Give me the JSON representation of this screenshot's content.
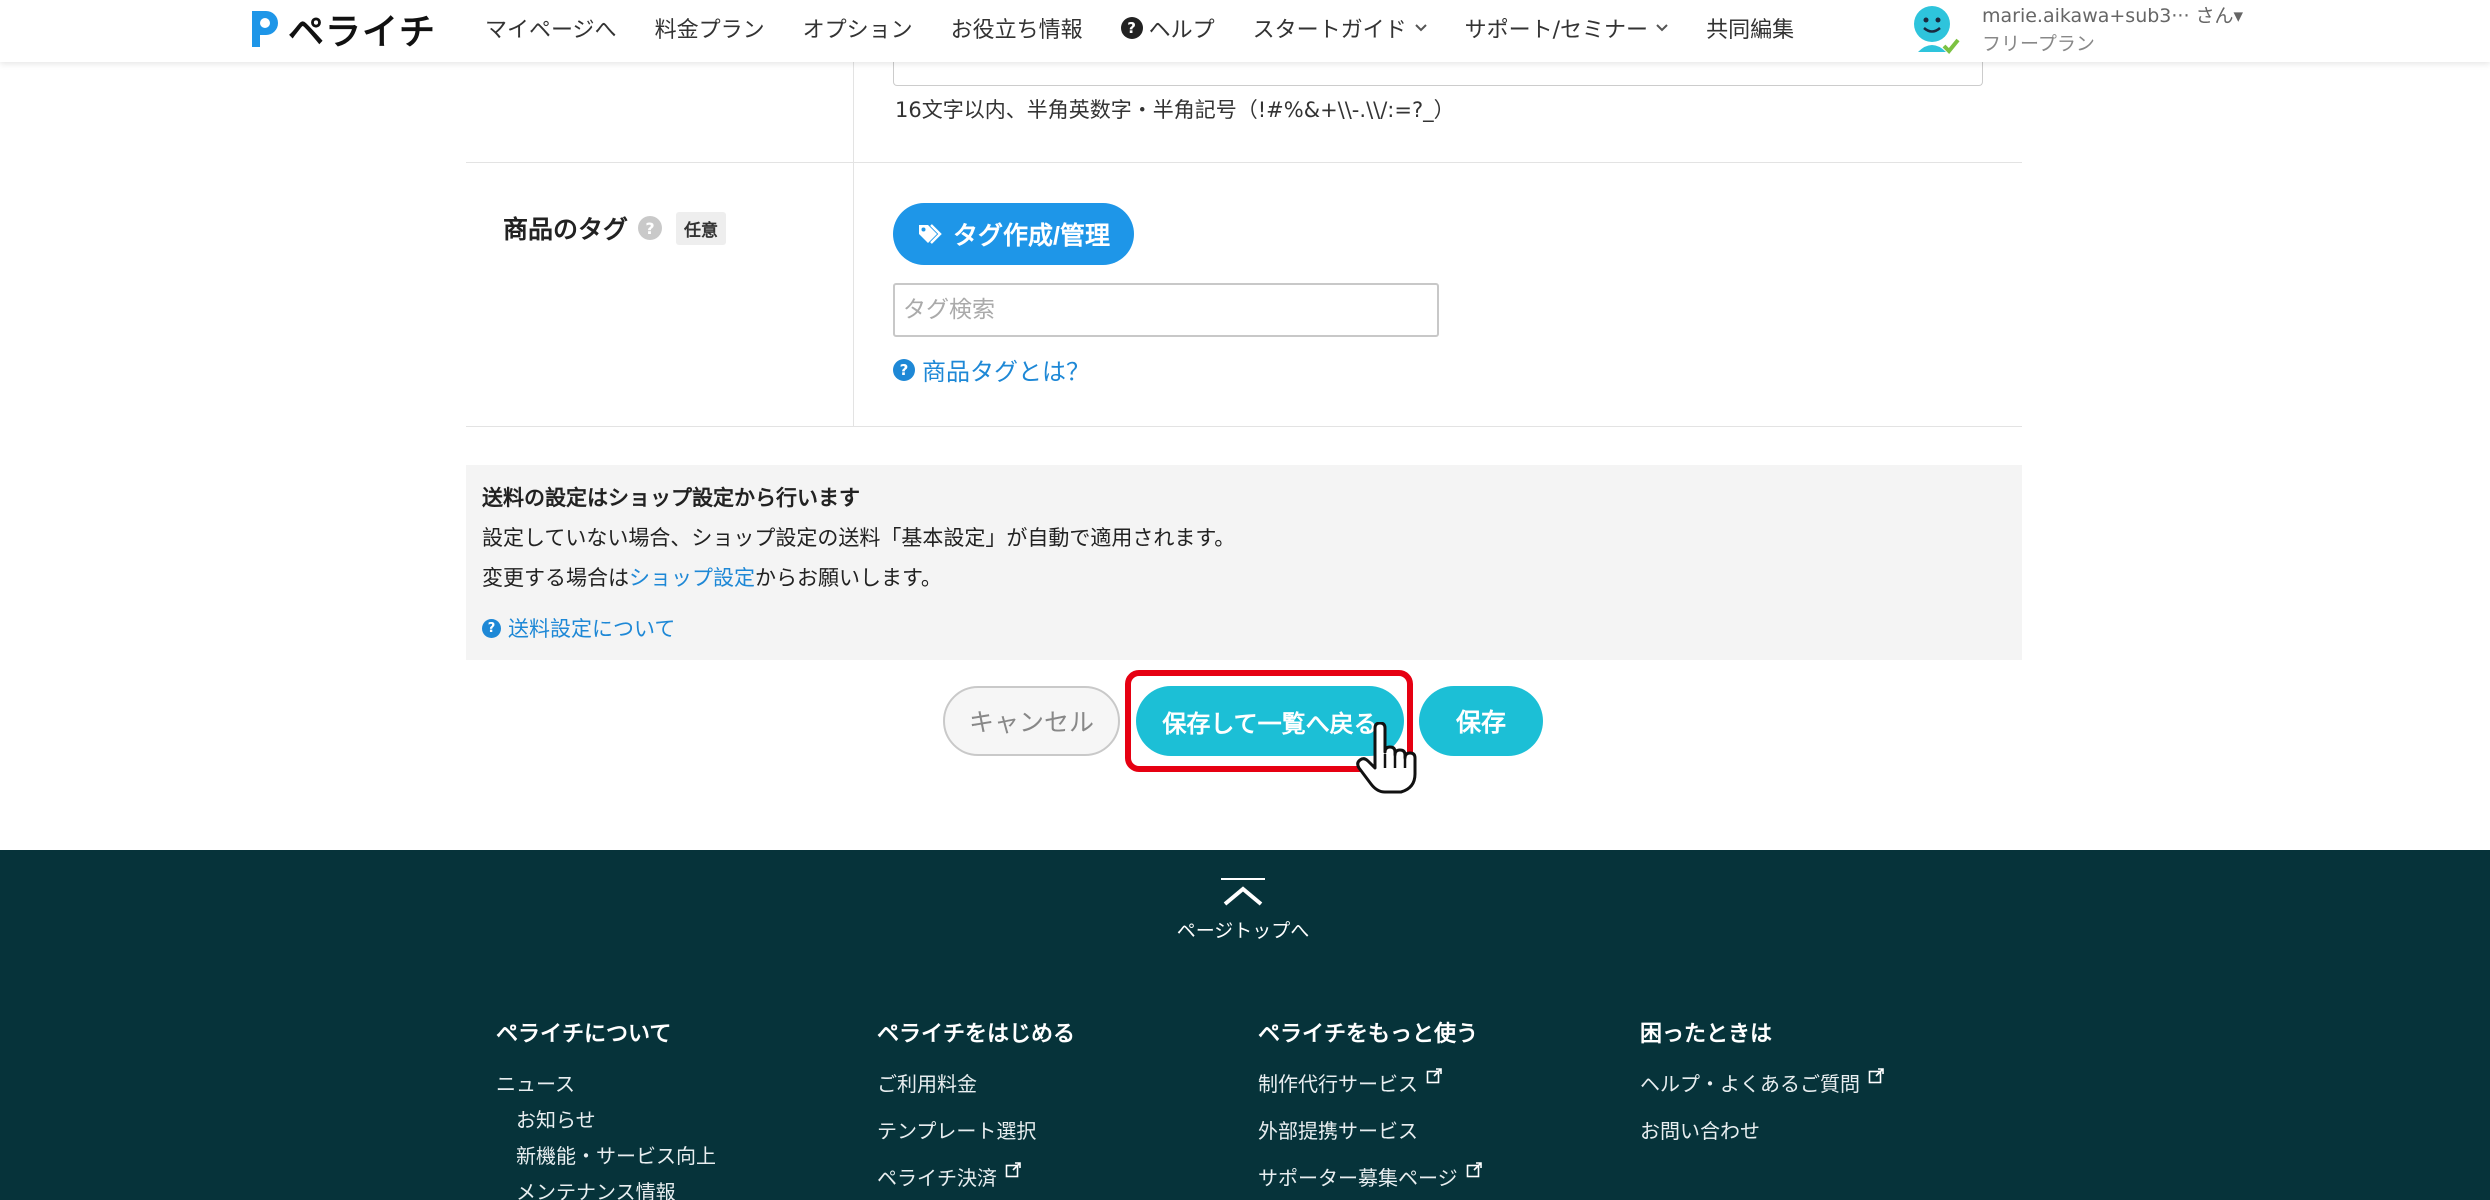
{
  "header": {
    "logo_text": "ペライチ",
    "nav": [
      {
        "label": "マイページへ",
        "dropdown": false
      },
      {
        "label": "料金プラン",
        "dropdown": false
      },
      {
        "label": "オプション",
        "dropdown": false
      },
      {
        "label": "お役立ち情報",
        "dropdown": false
      },
      {
        "label": "ヘルプ",
        "dropdown": false
      },
      {
        "label": "スタートガイド",
        "dropdown": true
      },
      {
        "label": "サポート/セミナー",
        "dropdown": true
      },
      {
        "label": "共同編集",
        "dropdown": false
      }
    ],
    "help_glyph": "?",
    "user_name": "marie.aikawa+sub3··· さん▾",
    "user_plan": "フリープラン"
  },
  "form": {
    "password_hint": "16文字以内、半角英数字・半角記号（!#%&+\\\\-.\\\\/:=?_）",
    "tag_label": "商品のタグ",
    "question_glyph": "?",
    "optional_badge": "任意",
    "tag_button_label": "タグ作成/管理",
    "tag_search_placeholder": "タグ検索",
    "tag_help_link": "商品タグとは？"
  },
  "notice": {
    "title": "送料の設定はショップ設定から行います",
    "line1": "設定していない場合、ショップ設定の送料「基本設定」が自動で適用されます。",
    "line2_prefix": "変更する場合は",
    "line2_link": "ショップ設定",
    "line2_suffix": "からお願いします。",
    "help_link": "送料設定について"
  },
  "buttons": {
    "cancel": "キャンセル",
    "save_and_back": "保存して一覧へ戻る",
    "save": "保存"
  },
  "footer": {
    "page_top": "ページトップへ",
    "columns": [
      {
        "title": "ペライチについて",
        "items": [
          {
            "label": "ニュース",
            "sub": false,
            "external": false
          },
          {
            "label": "お知らせ",
            "sub": true,
            "external": false
          },
          {
            "label": "新機能・サービス向上",
            "sub": true,
            "external": false
          },
          {
            "label": "メンテナンス情報",
            "sub": true,
            "external": false
          }
        ]
      },
      {
        "title": "ペライチをはじめる",
        "items": [
          {
            "label": "ご利用料金",
            "sub": false,
            "external": false
          },
          {
            "label": "テンプレート選択",
            "sub": false,
            "external": false
          },
          {
            "label": "ペライチ決済",
            "sub": false,
            "external": true
          }
        ]
      },
      {
        "title": "ペライチをもっと使う",
        "items": [
          {
            "label": "制作代行サービス",
            "sub": false,
            "external": true
          },
          {
            "label": "外部提携サービス",
            "sub": false,
            "external": false
          },
          {
            "label": "サポーター募集ページ",
            "sub": false,
            "external": true
          }
        ]
      },
      {
        "title": "困ったときは",
        "items": [
          {
            "label": "ヘルプ・よくあるご質問",
            "sub": false,
            "external": true
          },
          {
            "label": "お問い合わせ",
            "sub": false,
            "external": false
          }
        ]
      }
    ]
  },
  "colors": {
    "brand_blue": "#1e96e8",
    "save_button": "#1cbfd6",
    "highlight_red": "#e60012",
    "footer_bg": "#06333a",
    "link_blue": "#1e88d6"
  }
}
